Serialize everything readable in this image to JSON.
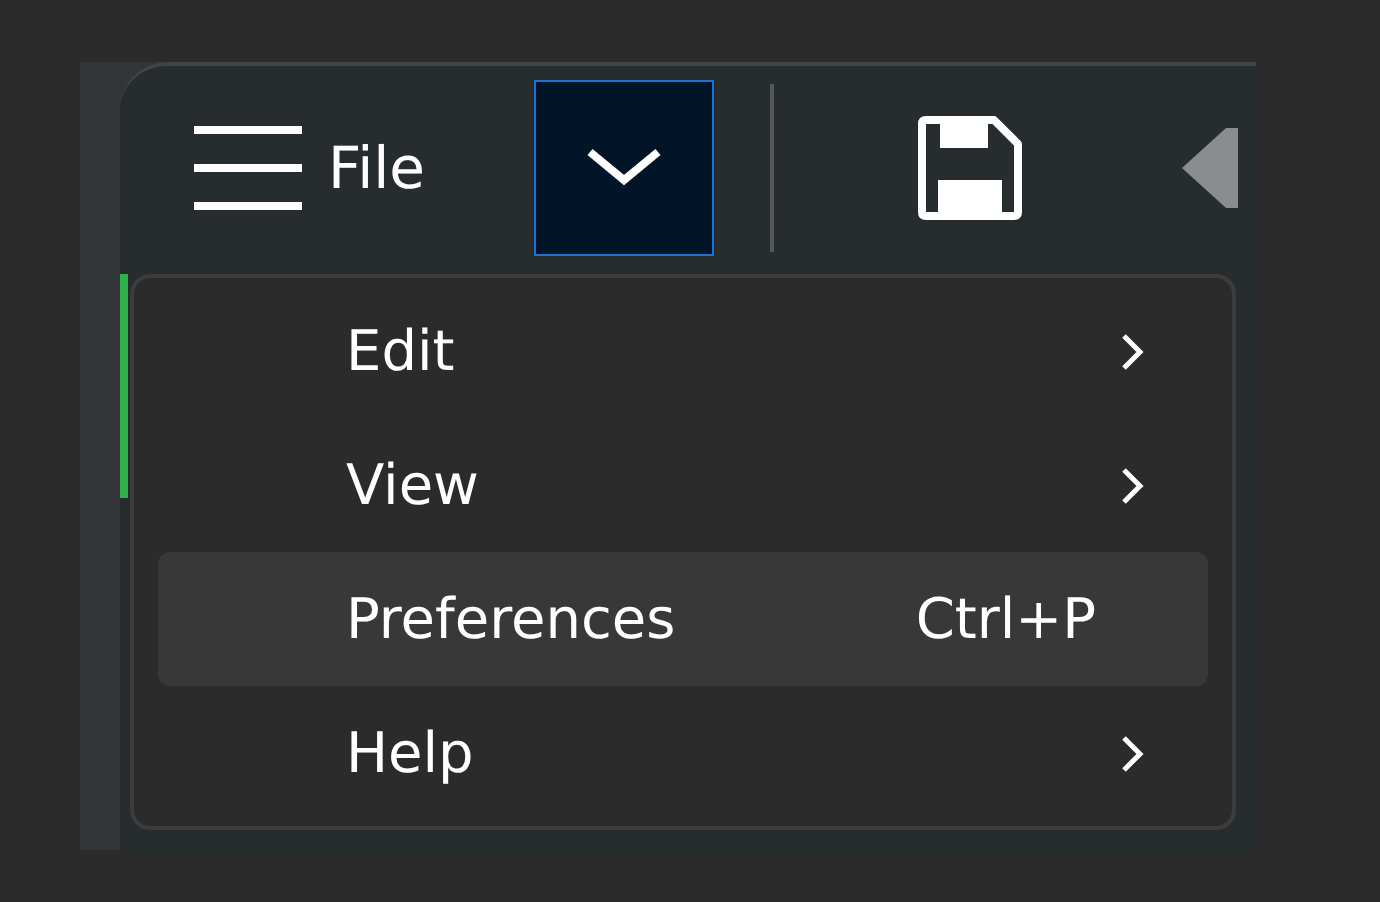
{
  "toolbar": {
    "menu_label": "File",
    "dropdown": {
      "selected": true
    }
  },
  "menu": {
    "items": [
      {
        "kind": "submenu",
        "label": "Edit",
        "selected": false
      },
      {
        "kind": "submenu",
        "label": "View",
        "selected": false
      },
      {
        "kind": "shortcut",
        "label": "Preferences",
        "shortcut": "Ctrl+P",
        "selected": true
      },
      {
        "kind": "submenu",
        "label": "Help",
        "selected": false
      }
    ]
  }
}
